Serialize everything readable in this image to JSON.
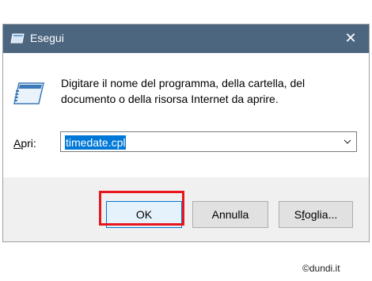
{
  "window": {
    "title": "Esegui",
    "close_glyph": "✕",
    "title_icon": "run-dialog-icon"
  },
  "dialog": {
    "icon": "run-icon",
    "description": "Digitare il nome del programma, della cartella, del documento o della risorsa Internet da aprire.",
    "open_label_prefix": "",
    "open_label_access_key": "A",
    "open_label_rest": "pri:",
    "open_value": "timedate.cpl"
  },
  "buttons": {
    "ok_label": "OK",
    "cancel_label": "Annulla",
    "browse_prefix": "S",
    "browse_access_key": "f",
    "browse_rest": "oglia..."
  },
  "colors": {
    "titlebar": "#4d6680",
    "selection": "#0078d7",
    "highlight": "#e8161c"
  },
  "watermark": "©dundi.it"
}
